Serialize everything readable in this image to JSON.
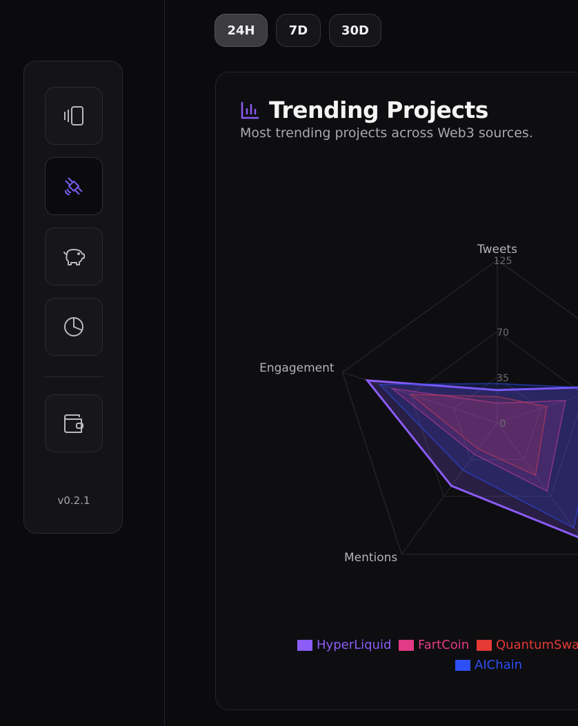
{
  "sidebar": {
    "items": [
      {
        "icon": "cards-icon"
      },
      {
        "icon": "satellite-icon"
      },
      {
        "icon": "piggy-bank-icon"
      },
      {
        "icon": "pie-chart-icon"
      },
      {
        "icon": "wallet-icon"
      }
    ],
    "version": "v0.2.1"
  },
  "ranges": [
    "24H",
    "7D",
    "30D"
  ],
  "card": {
    "title": "Trending Projects",
    "subtitle": "Most trending projects across Web3 sources."
  },
  "colors": {
    "accent": "#8b5cf6",
    "HyperLiquid": "#8b5cf6",
    "FartCoin": "#e33a86",
    "QuantumSwap": "#e53935",
    "AIChain": "#2d4ff5"
  },
  "chart_data": {
    "type": "radar",
    "axes": [
      "Tweets",
      "",
      "",
      "Mentions",
      "Engagement"
    ],
    "tick_labels": [
      "0",
      "35",
      "70",
      "125"
    ],
    "range": [
      0,
      125
    ],
    "series": [
      {
        "name": "HyperLiquid",
        "values": [
          25,
          90,
          110,
          60,
          105
        ]
      },
      {
        "name": "FartCoin",
        "values": [
          15,
          55,
          65,
          30,
          85
        ]
      },
      {
        "name": "QuantumSwap",
        "values": [
          20,
          40,
          50,
          25,
          70
        ]
      },
      {
        "name": "AIChain",
        "values": [
          30,
          85,
          100,
          45,
          95
        ]
      }
    ],
    "legend": [
      "HyperLiquid",
      "FartCoin",
      "QuantumSwap",
      "AIChain"
    ]
  }
}
